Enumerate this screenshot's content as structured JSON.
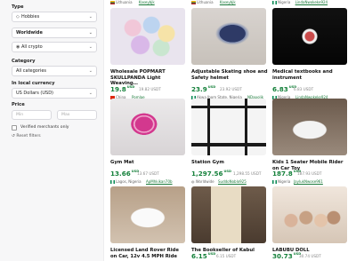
{
  "sidebar": {
    "type_label": "Type",
    "type_value": "Hobbies",
    "worldwide_value": "Worldwide",
    "crypto_value": "All crypto",
    "category_label": "Category",
    "category_value": "All categories",
    "currency_label": "In local currency",
    "currency_value": "US Dollars (USD)",
    "price_label": "Price",
    "min_placeholder": "Min",
    "max_placeholder": "Max",
    "verified_label": "Verified merchants only",
    "reset_label": "Reset filters"
  },
  "top_partial": [
    {
      "location": "Lithuania",
      "merchant": "Kaseybjk"
    },
    {
      "location": "Lithuania",
      "merchant": "Kaseybjk"
    },
    {
      "location": "Nigeria",
      "merchant": "LindaNwokeke924"
    }
  ],
  "products": [
    {
      "title": "Wholesale POPMART SKULLPANDA Light Weaving…",
      "price": "19.8",
      "currency": "USD",
      "usdt": "19.82 USDT",
      "location": "China",
      "merchant": "Pomlae",
      "flag": "china"
    },
    {
      "title": "Adjustable Skating shoe and Safety helmet",
      "price": "23.9",
      "currency": "USD",
      "usdt": "23.92 USDT",
      "location": "Akwa Ibom State, Nigeria",
      "merchant": "NDapolik",
      "flag": "nigeria"
    },
    {
      "title": "Medical textbooks and instrument",
      "price": "6.83",
      "currency": "USD",
      "usdt": "6.83 USDT",
      "location": "Nigeria",
      "merchant": "LindaNwokeke924",
      "flag": "nigeria"
    },
    {
      "title": "Gym Mat",
      "price": "13.66",
      "currency": "USD",
      "usdt": "13.67 USDT",
      "location": "Lagos, Nigeria",
      "merchant": "ApMhkikan70b",
      "flag": "nigeria"
    },
    {
      "title": "Station Gym",
      "price": "1,297.56",
      "currency": "USD",
      "usdt": "1,298.55 USDT",
      "location": "Worldwide",
      "merchant": "SuddoNoblo925",
      "flag": "globe"
    },
    {
      "title": "Kids 1 Seater Mobile Rider on Car Toy",
      "price": "187.8",
      "currency": "USD",
      "usdt": "187.93 USDT",
      "location": "Nigeria",
      "merchant": "JaylukNwose961",
      "flag": "nigeria"
    },
    {
      "title": "Licensed Land Rover Ride on Car, 12v 4.5 MPH Ride",
      "price": "",
      "currency": "",
      "usdt": "",
      "location": "",
      "merchant": "",
      "flag": ""
    },
    {
      "title": "The Bookseller of Kabul",
      "price": "6.15",
      "currency": "USD",
      "usdt": "6.15 USDT",
      "location": "",
      "merchant": "",
      "flag": ""
    },
    {
      "title": "LABUBU DOLL",
      "price": "30.73",
      "currency": "USD",
      "usdt": "30.74 USDT",
      "location": "",
      "merchant": "",
      "flag": ""
    }
  ]
}
